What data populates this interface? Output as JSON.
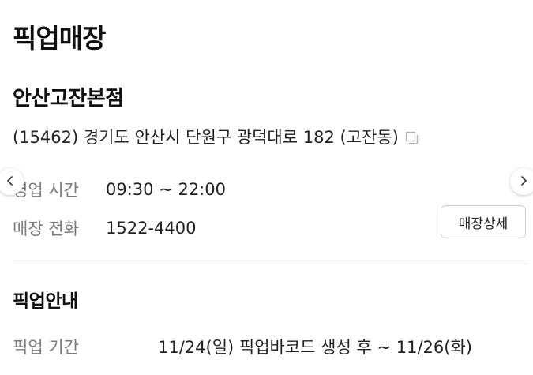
{
  "page": {
    "title": "픽업매장"
  },
  "store": {
    "name": "안산고잔본점",
    "address": "(15462) 경기도 안산시 단원구 광덕대로 182 (고잔동)",
    "copy_icon": "copy-icon"
  },
  "hours": {
    "label": "영업 시간",
    "value": "09:30 ~ 22:00"
  },
  "phone": {
    "label": "매장 전화",
    "value": "1522-4400"
  },
  "buttons": {
    "store_detail": "매장상세"
  },
  "navigation": {
    "prev_icon": "chevron-left-icon",
    "next_icon": "chevron-right-icon"
  },
  "pickup_info": {
    "title": "픽업안내",
    "period_label": "픽업 기간",
    "period_value": "11/24(일) 픽업바코드 생성 후 ~ 11/26(화)"
  },
  "colors": {
    "text_primary": "#111111",
    "text_label": "#7a7a7a",
    "divider": "#e6e6e6",
    "button_border": "#cfcfcf"
  }
}
